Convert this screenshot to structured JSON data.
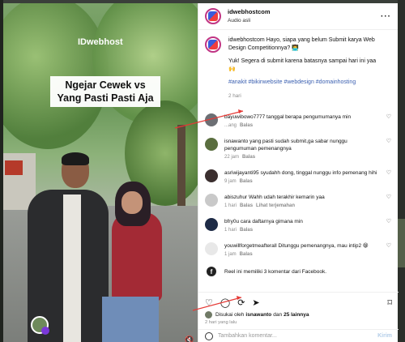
{
  "video": {
    "watermark": "IDwebhost",
    "caption": "Ngejar Cewek vs Yang Pasti Pasti Aja"
  },
  "header": {
    "account": "idwebhostcom",
    "audio": "Audio asli",
    "more": "···"
  },
  "post": {
    "username": "idwebhostcom",
    "text1": "Hayo, siapa yang belum Submit karya Web Design Competitionnya? 👨‍💻",
    "text2": "Yuk! Segera di submit karena batasnya sampai hari ini yaa 🙌",
    "tags": "#anakit #bikinwebsite #webdesign #domainhosting",
    "time": "2 hari"
  },
  "comments": [
    {
      "username": "bayuwibowo7777",
      "text": "tanggal berapa pengumumanya min",
      "time": "...ang",
      "reply": "Balas",
      "color": "#6c6f74"
    },
    {
      "username": "isnawanto",
      "text": "yang pasti sudah submit,ga sabar nunggu pengumuman pemenangnya",
      "time": "22 jam",
      "reply": "Balas",
      "color": "#5a6e3f"
    },
    {
      "username": "asriwijayanti95",
      "text": "syudahh dong, tinggal nunggu info pemenang hihi",
      "time": "9 jam",
      "reply": "Balas",
      "color": "#3b2f2f"
    },
    {
      "username": "abiszuhur",
      "text": "Wahh udah terakhir kemarin yaa",
      "time": "1 hari",
      "reply": "Balas",
      "view": "Lihat terjemahan",
      "color": "#c9c9c9"
    },
    {
      "username": "bfry0u",
      "text": "cara daftarnya gimana min",
      "time": "1 hari",
      "reply": "Balas",
      "color": "#1e2b46"
    },
    {
      "username": "youwillforgetmeafterall",
      "text": "Ditunggu pemenangnya, mau intip2 😁",
      "time": "1 jam",
      "reply": "Balas",
      "color": "#e8e8e8"
    }
  ],
  "facebook": {
    "text": "Reel ini memiliki 3 komentar dari Facebook."
  },
  "likes": {
    "prefix": "Disukai oleh",
    "user": "isnawanto",
    "mid": "dan",
    "count": "25 lainnya"
  },
  "footer": {
    "time": "2 hari yang lalu",
    "placeholder": "Tambahkan komentar...",
    "post": "Kirim"
  },
  "colors": {
    "link": "#3a5fb0",
    "arrow": "#e53935"
  }
}
